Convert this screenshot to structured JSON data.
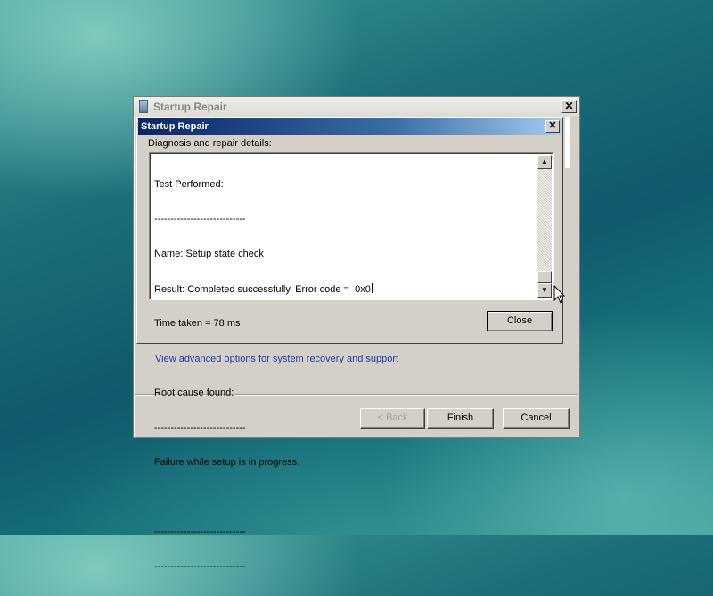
{
  "outer_window": {
    "title": "Startup Repair",
    "close_glyph": "✕",
    "advanced_link": "View advanced options for system recovery and support",
    "buttons": {
      "back": "< Back",
      "finish": "Finish",
      "cancel": "Cancel"
    }
  },
  "dialog": {
    "title": "Startup Repair",
    "close_glyph": "✕",
    "details_label": "Diagnosis and repair details:",
    "details_lines": [
      "Test Performed:",
      "----------------------------",
      "Name: Setup state check",
      "Result: Completed successfully. Error code =  0x0",
      "Time taken = 78 ms",
      "",
      "Root cause found:",
      "----------------------------",
      "Failure while setup is in progress.",
      "",
      "----------------------------",
      "----------------------------"
    ],
    "scroll_up_glyph": "▲",
    "scroll_down_glyph": "▼",
    "close_button": "Close"
  },
  "icons": {
    "outer_title_icon": "startup-repair-icon",
    "cursor": "arrow-cursor-icon"
  }
}
